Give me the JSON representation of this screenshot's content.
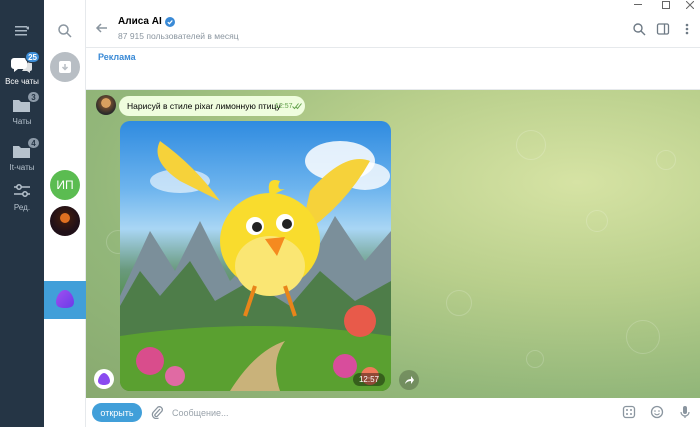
{
  "sidebar": {
    "folders": [
      {
        "label": "Все чаты",
        "badge": "25",
        "icon": "chats-icon",
        "active": true
      },
      {
        "label": "Чаты",
        "badge": "3",
        "icon": "folder-icon",
        "active": false
      },
      {
        "label": "It-чаты",
        "badge": "4",
        "icon": "folder-icon",
        "active": false
      },
      {
        "label": "Ред.",
        "badge": "",
        "icon": "edit-filters-icon",
        "active": false
      }
    ]
  },
  "chatlist": {
    "ip_initials": "ИП"
  },
  "header": {
    "title": "Алиса AI",
    "subtitle": "87 915 пользователей в месяц"
  },
  "ad": {
    "label": "Реклама"
  },
  "messages": {
    "outgoing_text": "Нарисуй в стиле pixar лимонную птицу",
    "outgoing_time": "12:57",
    "image_time": "12:57",
    "image_description": "yellow cartoon bird flying over mountains"
  },
  "composer": {
    "open_button": "открыть",
    "placeholder": "Сообщение..."
  },
  "colors": {
    "rail": "#253545",
    "accent": "#419fd9",
    "bubble_out": "#effdde"
  }
}
